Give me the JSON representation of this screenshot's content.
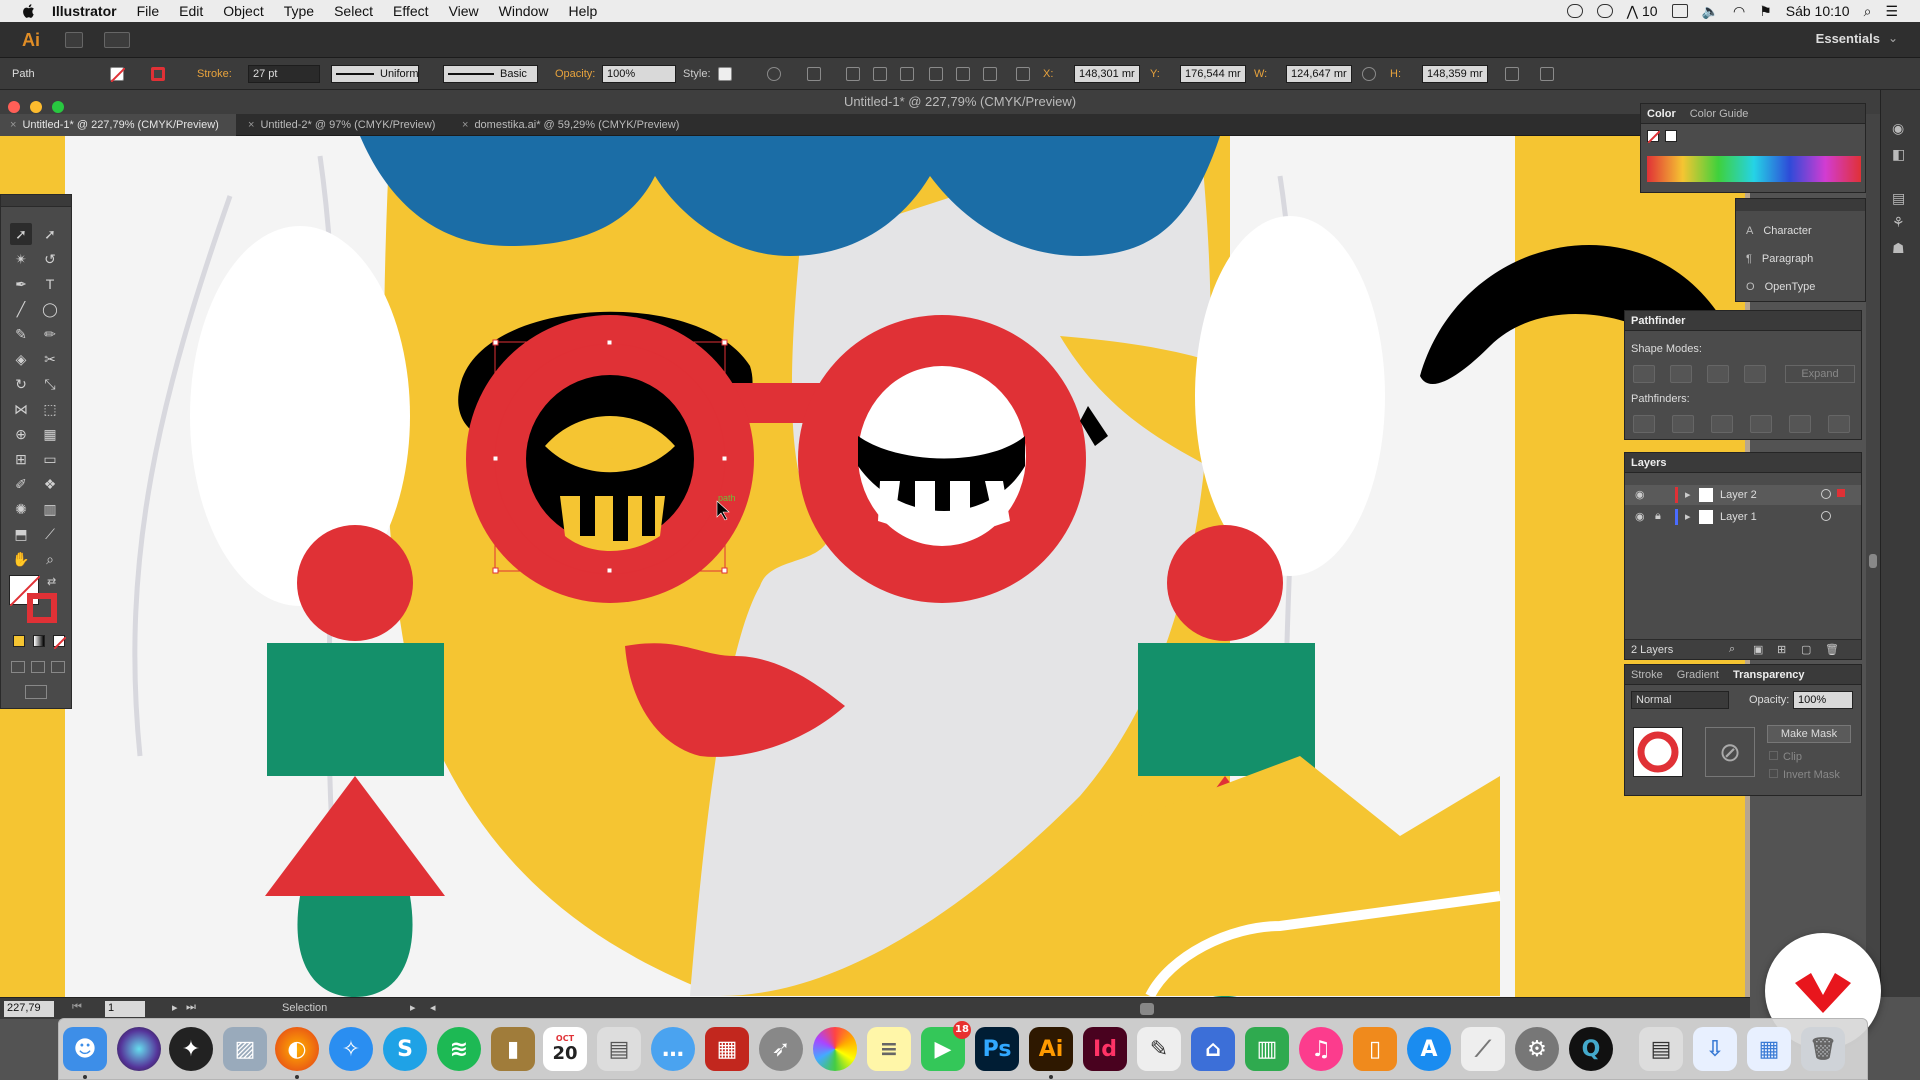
{
  "menubar": {
    "app_name": "Illustrator",
    "menus": [
      "File",
      "Edit",
      "Object",
      "Type",
      "Select",
      "Effect",
      "View",
      "Window",
      "Help"
    ],
    "status_number": "10",
    "clock": "Sáb 10:10"
  },
  "appbar": {
    "logo": "Ai",
    "workspace": "Essentials"
  },
  "controlbar": {
    "object_type": "Path",
    "stroke_label": "Stroke:",
    "stroke_value": "27 pt",
    "profile_value": "Uniform",
    "brush_value": "Basic",
    "opacity_label": "Opacity:",
    "opacity_value": "100%",
    "style_label": "Style:",
    "x_label": "X:",
    "x_value": "148,301 mr",
    "y_label": "Y:",
    "y_value": "176,544 mr",
    "w_label": "W:",
    "w_value": "124,647 mr",
    "h_label": "H:",
    "h_value": "148,359 mr"
  },
  "window": {
    "title": "Untitled-1* @ 227,79% (CMYK/Preview)"
  },
  "tabs": [
    {
      "label": "Untitled-1* @ 227,79% (CMYK/Preview)"
    },
    {
      "label": "Untitled-2* @ 97% (CMYK/Preview)"
    },
    {
      "label": "domestika.ai* @ 59,29% (CMYK/Preview)"
    }
  ],
  "canvas": {
    "cursor_hint": "path"
  },
  "panels": {
    "color": {
      "tab_color": "Color",
      "tab_guide": "Color Guide"
    },
    "type_panels": [
      "Character",
      "Paragraph",
      "OpenType"
    ],
    "pathfinder": {
      "title": "Pathfinder",
      "shape_modes": "Shape Modes:",
      "expand": "Expand",
      "pathfinders": "Pathfinders:"
    },
    "layers": {
      "title": "Layers",
      "rows": [
        {
          "name": "Layer 2"
        },
        {
          "name": "Layer 1"
        }
      ],
      "count": "2 Layers"
    },
    "transparency": {
      "tabs": [
        "Stroke",
        "Gradient",
        "Transparency"
      ],
      "blend_mode": "Normal",
      "opacity_label": "Opacity:",
      "opacity_value": "100%",
      "make_mask": "Make Mask",
      "clip": "Clip",
      "invert_mask": "Invert Mask"
    }
  },
  "statusbar": {
    "zoom": "227,79",
    "artboard": "1",
    "tool": "Selection"
  },
  "dock": {
    "calendar_month": "OCT",
    "calendar_day": "20",
    "facetime_badge": "18",
    "apps": [
      "Finder",
      "Siri",
      "Launchpad",
      "Preview",
      "Firefox",
      "Safari",
      "Skype",
      "Spotify",
      "Notefile",
      "Calendar",
      "Photos",
      "Messages",
      "Photo Booth",
      "Rocket",
      "Photos",
      "Notes",
      "FaceTime",
      "Photoshop",
      "Illustrator",
      "InDesign",
      "Keynote",
      "Numbers",
      "iTunes",
      "iBooks",
      "App Store",
      "TextEdit",
      "System Preferences",
      "QuickTime",
      "Archive",
      "Downloads",
      "Trash"
    ],
    "ps": "Ps",
    "ai": "Ai",
    "id": "Id"
  },
  "colors": {
    "yellow": "#f5c532",
    "red": "#e03136",
    "blue": "#1b6da6",
    "green": "#14906a",
    "grey": "#e4e4e6",
    "accent_orange": "#e08d26"
  }
}
